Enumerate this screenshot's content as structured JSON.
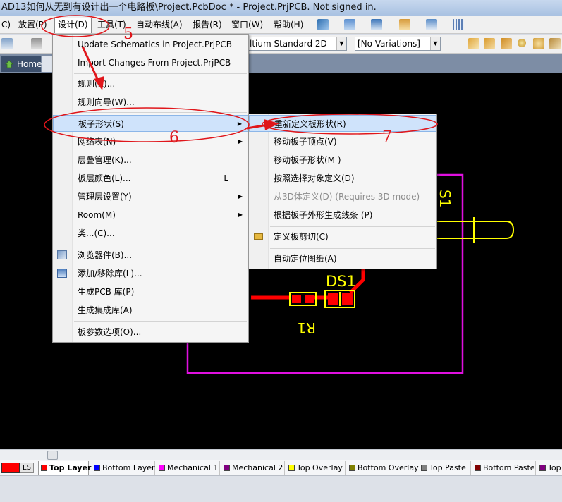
{
  "window": {
    "title": "AD13如何从无到有设计出一个电路板\\Project.PcbDoc * - Project.PrjPCB. Not signed in."
  },
  "menubar": {
    "items": [
      {
        "label": "C)"
      },
      {
        "label": "放置(P)"
      },
      {
        "label": "设计(D)"
      },
      {
        "label": "工具(T)"
      },
      {
        "label": "自动布线(A)"
      },
      {
        "label": "报告(R)"
      },
      {
        "label": "窗口(W)"
      },
      {
        "label": "帮助(H)"
      }
    ]
  },
  "toolbar": {
    "view_combo": "ltium Standard 2D",
    "variations_combo": "[No Variations]"
  },
  "tabs": {
    "home": "Home"
  },
  "design_menu": {
    "items": [
      {
        "label": "Update Schematics in Project.PrjPCB"
      },
      {
        "label": "Import Changes From Project.PrjPCB"
      },
      {
        "label": "规则(R)..."
      },
      {
        "label": "规则向导(W)..."
      },
      {
        "label": "板子形状(S)"
      },
      {
        "label": "网络表(N)"
      },
      {
        "label": "层叠管理(K)..."
      },
      {
        "label": "板层颜色(L)...",
        "shortcut": "L"
      },
      {
        "label": "管理层设置(Y)"
      },
      {
        "label": "Room(M)"
      },
      {
        "label": "类...(C)..."
      },
      {
        "label": "浏览器件(B)..."
      },
      {
        "label": "添加/移除库(L)..."
      },
      {
        "label": "生成PCB 库(P)"
      },
      {
        "label": "生成集成库(A)"
      },
      {
        "label": "板参数选项(O)..."
      }
    ]
  },
  "board_shape_menu": {
    "items": [
      {
        "label": "重新定义板形状(R)"
      },
      {
        "label": "移动板子顶点(V)"
      },
      {
        "label": "移动板子形状(M )"
      },
      {
        "label": "按照选择对象定义(D)"
      },
      {
        "label": "从3D体定义(D) (Requires 3D mode)"
      },
      {
        "label": "根据板子外形生成线条 (P)"
      },
      {
        "label": "定义板剪切(C)"
      },
      {
        "label": "自动定位图纸(A)"
      }
    ]
  },
  "pcb": {
    "designators": {
      "ds1": "DS1",
      "r1": "R1",
      "s1": "S1"
    },
    "colors": {
      "board_outline": "#e010e0",
      "track": "#ff0000",
      "silk": "#ffff00",
      "background": "#000000"
    }
  },
  "annotations": {
    "step5": "5",
    "step6": "6",
    "step7": "7"
  },
  "layers": {
    "ls": "LS",
    "tabs": [
      {
        "label": "Top Layer",
        "color": "#ff0000"
      },
      {
        "label": "Bottom Layer",
        "color": "#0000ff"
      },
      {
        "label": "Mechanical 1",
        "color": "#ff00ff"
      },
      {
        "label": "Mechanical 2",
        "color": "#800080"
      },
      {
        "label": "Top Overlay",
        "color": "#ffff00"
      },
      {
        "label": "Bottom Overlay",
        "color": "#808000"
      },
      {
        "label": "Top Paste",
        "color": "#808080"
      },
      {
        "label": "Bottom Paste",
        "color": "#800000"
      },
      {
        "label": "Top",
        "color": "#800080"
      }
    ]
  }
}
